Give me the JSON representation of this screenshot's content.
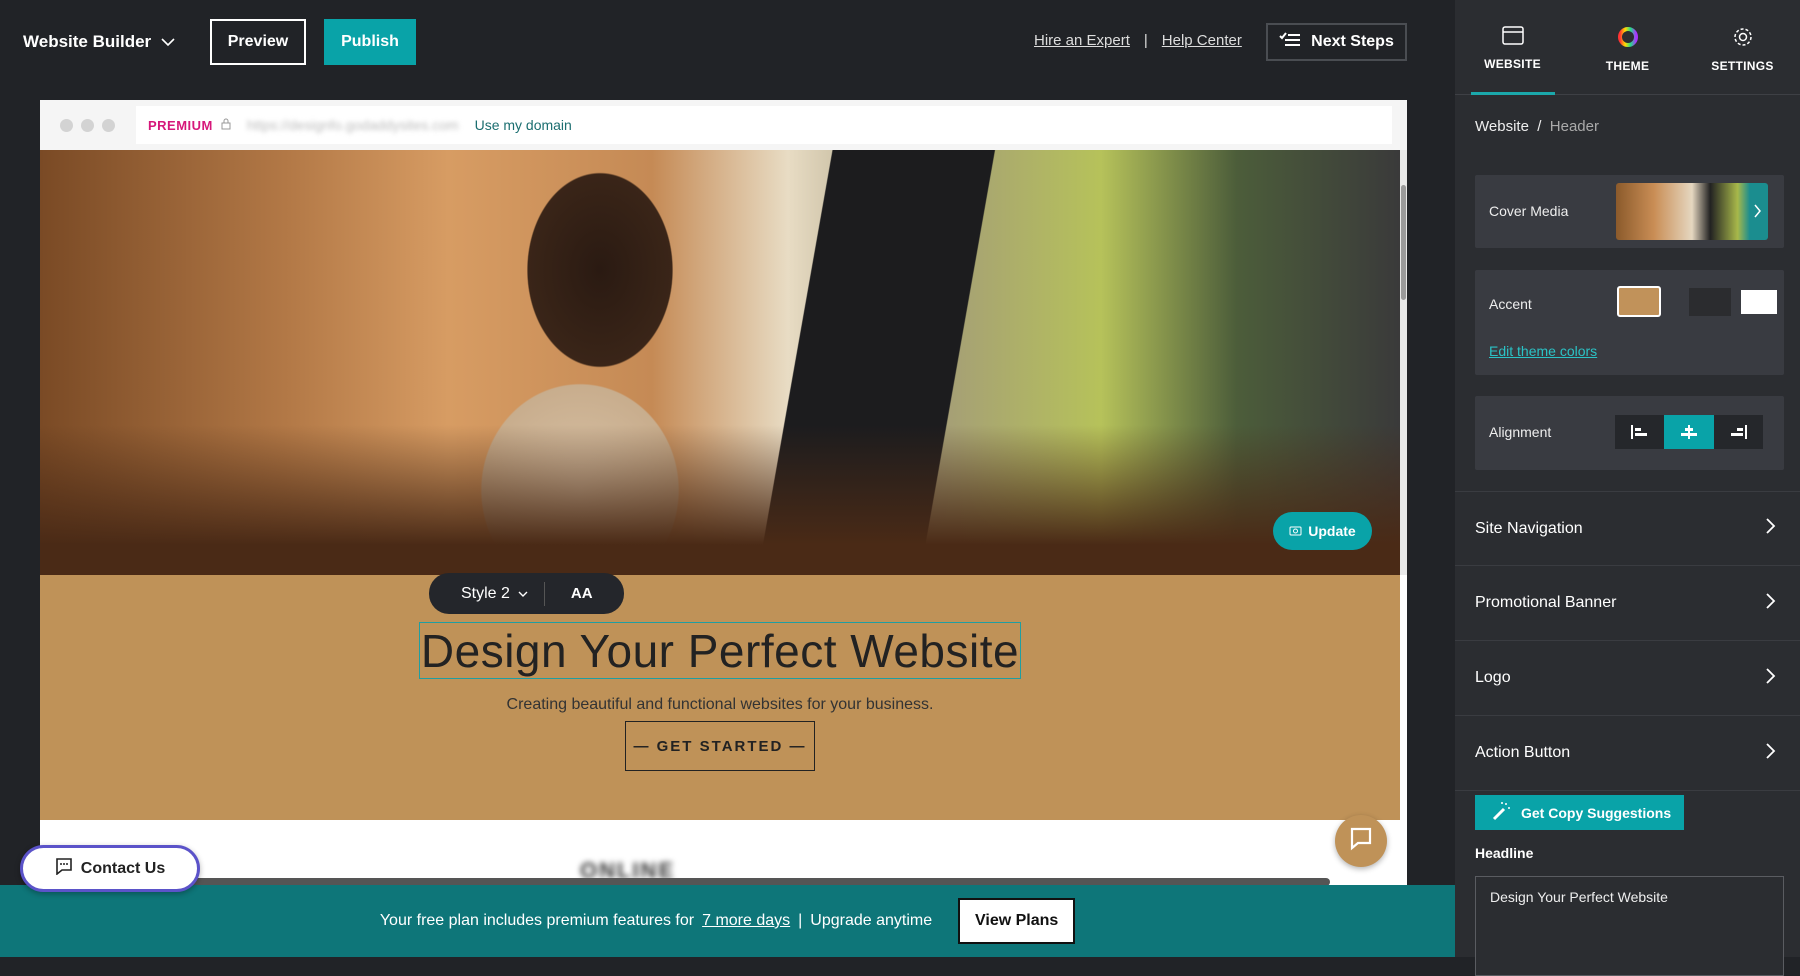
{
  "topbar": {
    "brand": "Website Builder",
    "preview": "Preview",
    "publish": "Publish",
    "hire": "Hire an Expert",
    "sep": "|",
    "help": "Help Center",
    "next_steps": "Next Steps"
  },
  "browser": {
    "premium": "PREMIUM",
    "url": "https://designfo.godaddysites.com",
    "use_domain": "Use my domain"
  },
  "hero": {
    "update": "Update",
    "style": "Style 2",
    "font_size_icon": "AA",
    "headline": "Design Your Perfect Website",
    "subtitle": "Creating beautiful and functional websites for your business.",
    "cta": "— GET STARTED —",
    "next_section": "ONLINE APPOINTMENTS"
  },
  "contact": "Contact Us",
  "banner": {
    "text": "Your free plan includes premium features for",
    "days": "7 more days",
    "sep": "|",
    "upgrade": "Upgrade anytime",
    "view_plans": "View Plans"
  },
  "panel": {
    "tabs": [
      {
        "label": "WEBSITE",
        "icon": "browser-window-icon",
        "active": true
      },
      {
        "label": "THEME",
        "icon": "color-ring-icon"
      },
      {
        "label": "SETTINGS",
        "icon": "gear-icon"
      }
    ],
    "breadcrumb": {
      "root": "Website",
      "sep": "/",
      "current": "Header"
    },
    "cover_media": "Cover Media",
    "accent": {
      "label": "Accent",
      "swatches": [
        "#c1925a",
        "#2b2c2f",
        "#ffffff"
      ],
      "selected": 0,
      "edit": "Edit theme colors"
    },
    "alignment": {
      "label": "Alignment",
      "options": [
        "left",
        "center",
        "right"
      ],
      "selected": "center"
    },
    "rows": [
      "Site Navigation",
      "Promotional Banner",
      "Logo",
      "Action Button"
    ],
    "copy_button": "Get Copy Suggestions",
    "headline_label": "Headline",
    "headline_value": "Design Your Perfect Website"
  },
  "colors": {
    "accent": "#09a3a8",
    "hero_bg": "#bf9258",
    "banner": "#0e7679",
    "panel": "#2b2d31"
  }
}
